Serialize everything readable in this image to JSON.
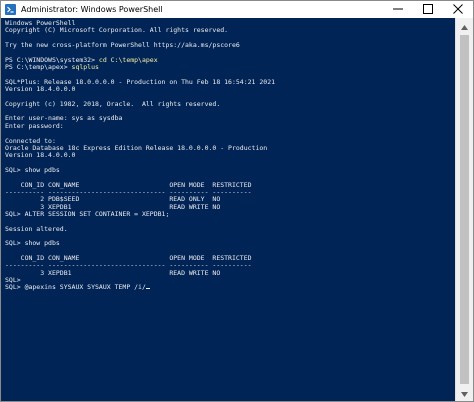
{
  "window": {
    "title": "Administrator: Windows PowerShell"
  },
  "titlebar": {
    "icon": "powershell-icon",
    "buttons": [
      "minimize-icon",
      "maximize-icon",
      "close-icon"
    ]
  },
  "scrollbar": {
    "icons": [
      "scroll-up-icon",
      "scroll-down-icon"
    ]
  },
  "colors": {
    "console_bg": "#012456",
    "console_fg": "#eeedf0",
    "command_fg": "#f9f1a5"
  },
  "console": {
    "lines": [
      {
        "text": "Windows PowerShell"
      },
      {
        "text": "Copyright (C) Microsoft Corporation. All rights reserved."
      },
      {
        "text": ""
      },
      {
        "text": "Try the new cross-platform PowerShell https://aka.ms/pscore6"
      },
      {
        "text": ""
      },
      {
        "prompt": "PS C:\\WINDOWS\\system32> ",
        "command": "cd C:\\temp\\apex"
      },
      {
        "prompt": "PS C:\\temp\\apex> ",
        "command": "sqlplus"
      },
      {
        "text": ""
      },
      {
        "text": "SQL*Plus: Release 18.0.0.0.0 - Production on Thu Feb 18 16:54:21 2021"
      },
      {
        "text": "Version 18.4.0.0.0"
      },
      {
        "text": ""
      },
      {
        "text": "Copyright (c) 1982, 2018, Oracle.  All rights reserved."
      },
      {
        "text": ""
      },
      {
        "text": "Enter user-name: sys as sysdba"
      },
      {
        "text": "Enter password:"
      },
      {
        "text": ""
      },
      {
        "text": "Connected to:"
      },
      {
        "text": "Oracle Database 18c Express Edition Release 18.0.0.0.0 - Production"
      },
      {
        "text": "Version 18.4.0.0.0"
      },
      {
        "text": ""
      },
      {
        "text": "SQL> show pdbs"
      },
      {
        "text": ""
      },
      {
        "text": "    CON_ID CON_NAME                       OPEN MODE  RESTRICTED"
      },
      {
        "text": "---------- ------------------------------ ---------- ----------"
      },
      {
        "text": "         2 PDB$SEED                       READ ONLY  NO"
      },
      {
        "text": "         3 XEPDB1                         READ WRITE NO"
      },
      {
        "text": "SQL> ALTER SESSION SET CONTAINER = XEPDB1;"
      },
      {
        "text": ""
      },
      {
        "text": "Session altered."
      },
      {
        "text": ""
      },
      {
        "text": "SQL> show pdbs"
      },
      {
        "text": ""
      },
      {
        "text": "    CON_ID CON_NAME                       OPEN MODE  RESTRICTED"
      },
      {
        "text": "---------- ------------------------------ ---------- ----------"
      },
      {
        "text": "         3 XEPDB1                         READ WRITE NO"
      },
      {
        "text": "SQL>"
      },
      {
        "text": "SQL> @apexins SYSAUX SYSAUX TEMP /i/",
        "cursor": true
      }
    ]
  }
}
